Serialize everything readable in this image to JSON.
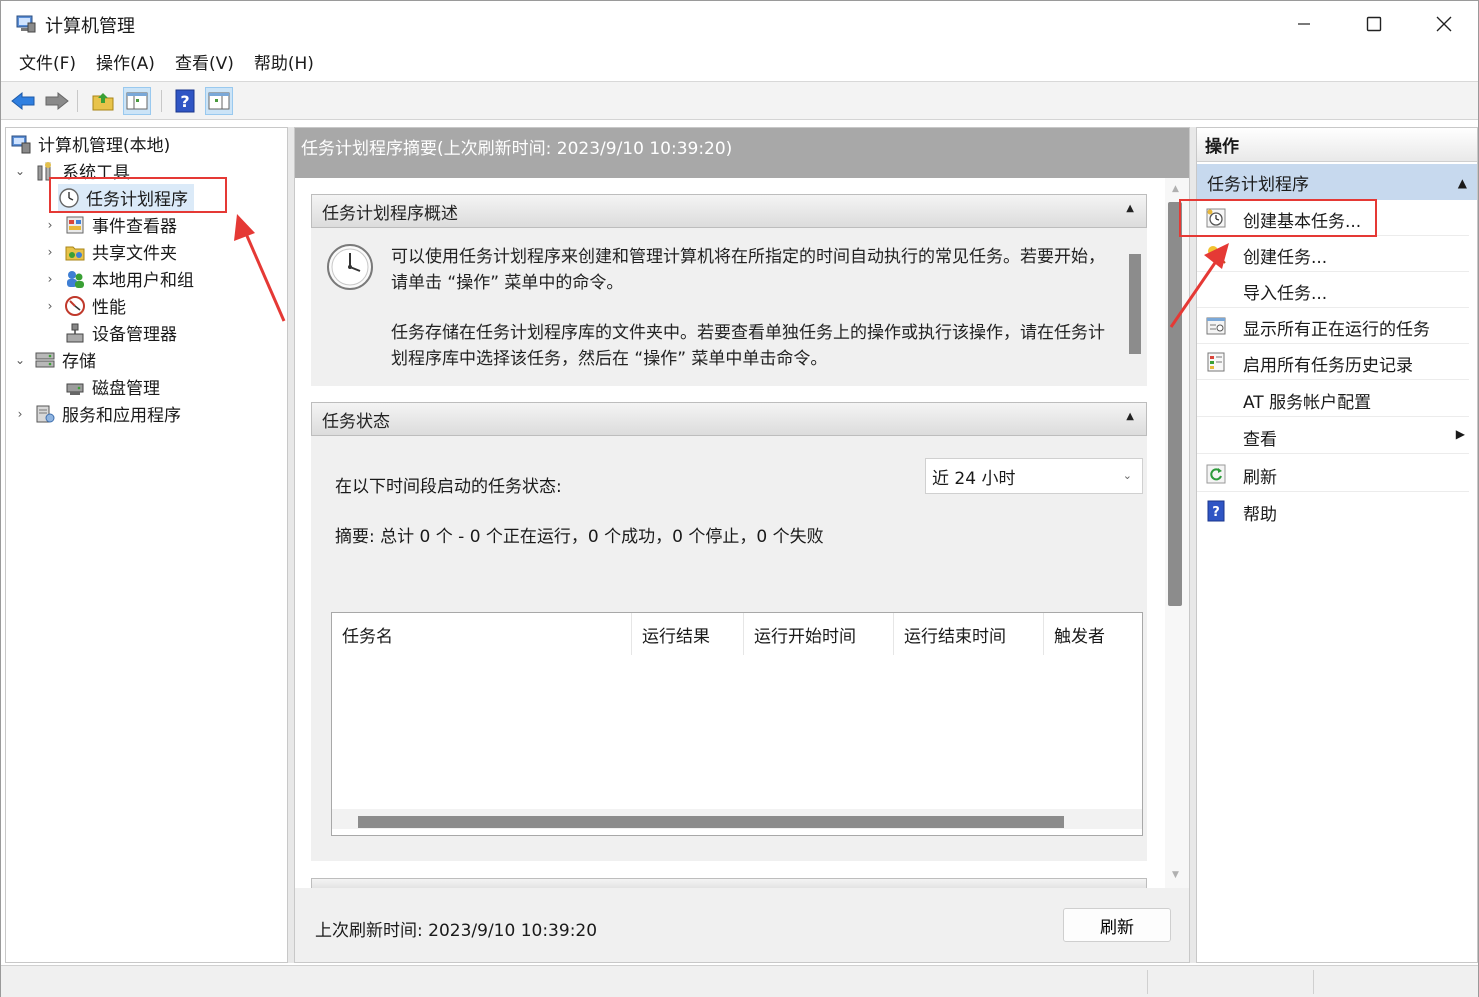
{
  "window": {
    "title": "计算机管理"
  },
  "menu": {
    "items": [
      "文件(F)",
      "操作(A)",
      "查看(V)",
      "帮助(H)"
    ]
  },
  "toolbar": {
    "buttons": [
      "back-icon",
      "forward-icon",
      "folder-up-icon",
      "show-hide-tree-icon",
      "help-icon",
      "action-pane-icon"
    ]
  },
  "tree": {
    "root": "计算机管理(本地)",
    "items": [
      {
        "label": "系统工具",
        "expanded": true
      },
      {
        "label": "任务计划程序",
        "selected": true
      },
      {
        "label": "事件查看器"
      },
      {
        "label": "共享文件夹"
      },
      {
        "label": "本地用户和组"
      },
      {
        "label": "性能"
      },
      {
        "label": "设备管理器"
      },
      {
        "label": "存储",
        "expanded": true
      },
      {
        "label": "磁盘管理"
      },
      {
        "label": "服务和应用程序"
      }
    ]
  },
  "main": {
    "header": "任务计划程序摘要(上次刷新时间: 2023/9/10 10:39:20)",
    "overview": {
      "title": "任务计划程序概述",
      "para1": "可以使用任务计划程序来创建和管理计算机将在所指定的时间自动执行的常见任务。若要开始，请单击 “操作” 菜单中的命令。",
      "para2": "任务存储在任务计划程序库的文件夹中。若要查看单独任务上的操作或执行该操作，请在任务计划程序库中选择该任务，然后在 “操作” 菜单中单击命令。"
    },
    "status": {
      "title": "任务状态",
      "label": "在以下时间段启动的任务状态:",
      "period": "近 24 小时",
      "summary": "摘要: 总计 0 个 - 0 个正在运行，0 个成功，0 个停止，0 个失败",
      "columns": [
        "任务名",
        "运行结果",
        "运行开始时间",
        "运行结束时间",
        "触发者"
      ]
    },
    "footer": {
      "last_refresh": "上次刷新时间: 2023/9/10 10:39:20",
      "refresh_button": "刷新"
    }
  },
  "actions": {
    "title": "操作",
    "section": "任务计划程序",
    "items": [
      {
        "label": "创建基本任务...",
        "icon": "create-basic-task-icon"
      },
      {
        "label": "创建任务...",
        "icon": "create-task-icon"
      },
      {
        "label": "导入任务...",
        "icon": ""
      },
      {
        "label": "显示所有正在运行的任务",
        "icon": "running-tasks-icon"
      },
      {
        "label": "启用所有任务历史记录",
        "icon": "task-history-icon"
      },
      {
        "label": "AT 服务帐户配置",
        "icon": ""
      },
      {
        "label": "查看",
        "icon": "",
        "submenu": true
      },
      {
        "label": "刷新",
        "icon": "refresh-icon"
      },
      {
        "label": "帮助",
        "icon": "help-icon"
      }
    ]
  },
  "colors": {
    "highlight": "#e53935",
    "selection": "#dbeaf8",
    "action_section": "#c7d9ee"
  }
}
